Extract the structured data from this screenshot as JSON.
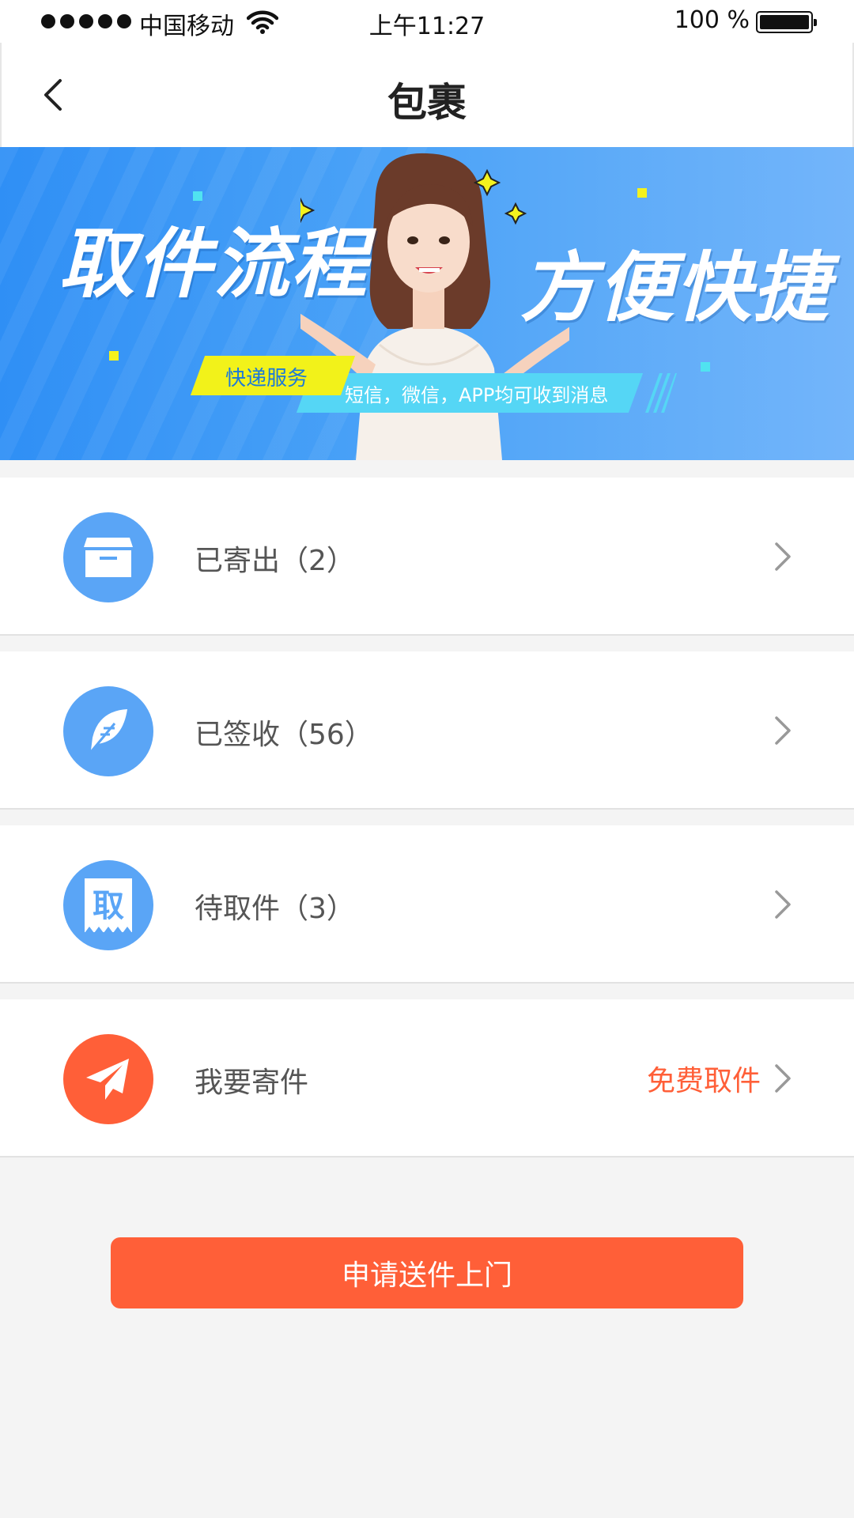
{
  "status_bar": {
    "carrier": "中国移动",
    "time": "上午11:27",
    "battery_percent": "100 %",
    "battery_level": 1.0
  },
  "nav": {
    "title": "包裹",
    "back_icon": "chevron-left-icon"
  },
  "banner": {
    "heading_left": "取件流程",
    "heading_right": "方便快捷",
    "tag_primary": "快递服务",
    "tag_secondary": "短信，微信，APP均可收到消息"
  },
  "menu": {
    "items": [
      {
        "label": "已寄出（2）",
        "icon": "package-box-icon",
        "icon_color": "#5aa5f6"
      },
      {
        "label": "已签收（56）",
        "icon": "feather-icon",
        "icon_color": "#5aa5f6"
      },
      {
        "label": "待取件（3）",
        "icon": "pickup-ticket-icon",
        "icon_glyph": "取",
        "icon_color": "#5aa5f6"
      },
      {
        "label": "我要寄件",
        "icon": "paper-plane-icon",
        "icon_color": "#ff5f38",
        "extra": "免费取件",
        "extra_color": "#ff5f38"
      }
    ]
  },
  "action": {
    "button_label": "申请送件上门",
    "button_color": "#ff5f38"
  }
}
